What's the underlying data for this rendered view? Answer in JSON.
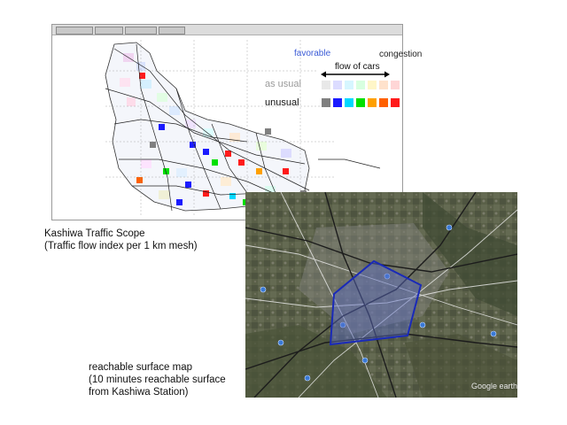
{
  "scope_caption": {
    "line1": "Kashiwa Traffic Scope",
    "line2": "(Traffic flow index per 1 km mesh)"
  },
  "legend": {
    "favorable": "favorable",
    "congestion": "congestion",
    "flow": "flow of cars",
    "as_usual": "as usual",
    "unusual": "unusual",
    "usual_colors": [
      "#e8e8e8",
      "#dcdcff",
      "#d6f6ff",
      "#d8ffe0",
      "#fff6c8",
      "#ffe2cc",
      "#ffd6d6"
    ],
    "unusual_colors": [
      "#808080",
      "#1a1aff",
      "#00d8ff",
      "#00e000",
      "#ffa000",
      "#ff6000",
      "#ff1a1a"
    ]
  },
  "reach_caption": {
    "line1": "reachable surface map",
    "line2": "(10 minutes reachable surface",
    "line3": "from Kashiwa Station)"
  },
  "satellite": {
    "watermark": "Google earth"
  }
}
